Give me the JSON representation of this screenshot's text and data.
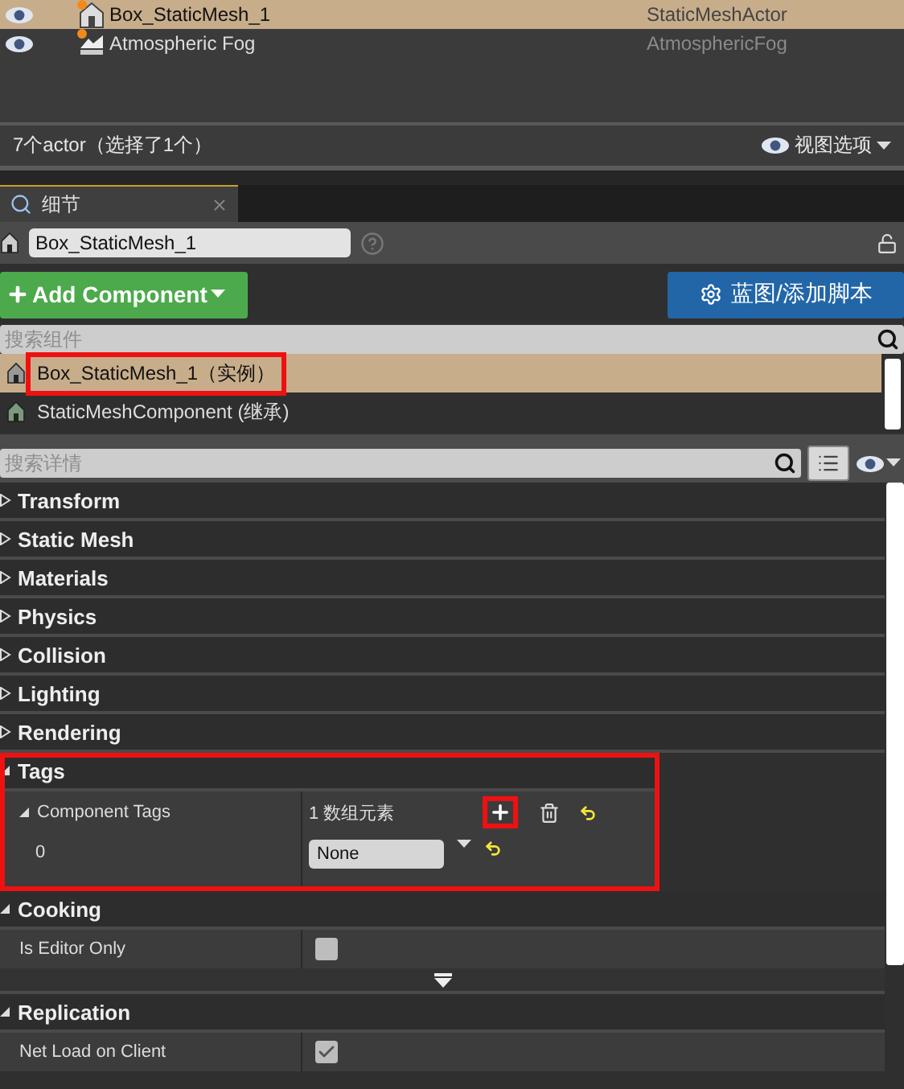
{
  "outliner": {
    "rows": [
      {
        "label": "Box_StaticMesh_1",
        "type": "StaticMeshActor",
        "kind": "mesh",
        "selected": true
      },
      {
        "label": "Atmospheric Fog",
        "type": "AtmosphericFog",
        "kind": "fog",
        "selected": false
      }
    ],
    "status": "7个actor（选择了1个）",
    "view_options": "视图选项"
  },
  "details_tab": {
    "title": "细节"
  },
  "actor_name": "Box_StaticMesh_1",
  "add_component": "Add Component",
  "blueprint_button": "蓝图/添加脚本",
  "component_search": {
    "placeholder": "搜索组件"
  },
  "components": [
    {
      "label": "Box_StaticMesh_1（实例）",
      "selected": true,
      "highlighted": true
    },
    {
      "label": "StaticMeshComponent (继承)",
      "selected": false,
      "highlighted": false
    }
  ],
  "details_search": {
    "placeholder": "搜索详情"
  },
  "categories": [
    {
      "title": "Transform",
      "expanded": false
    },
    {
      "title": "Static Mesh",
      "expanded": false
    },
    {
      "title": "Materials",
      "expanded": false
    },
    {
      "title": "Physics",
      "expanded": false
    },
    {
      "title": "Collision",
      "expanded": false
    },
    {
      "title": "Lighting",
      "expanded": false
    },
    {
      "title": "Rendering",
      "expanded": false
    },
    {
      "title": "Tags",
      "expanded": true,
      "highlighted": true,
      "properties": [
        {
          "kind": "array",
          "label": "Component Tags",
          "value": "1 数组元素",
          "add_highlighted": true
        },
        {
          "kind": "element",
          "label": "0",
          "value": "None"
        }
      ]
    },
    {
      "title": "Cooking",
      "expanded": true,
      "advanced": true,
      "properties": [
        {
          "kind": "checkbox",
          "label": "Is Editor Only",
          "checked": false
        }
      ]
    },
    {
      "title": "Replication",
      "expanded": true,
      "properties": [
        {
          "kind": "checkbox",
          "label": "Net Load on Client",
          "checked": true
        }
      ]
    }
  ]
}
